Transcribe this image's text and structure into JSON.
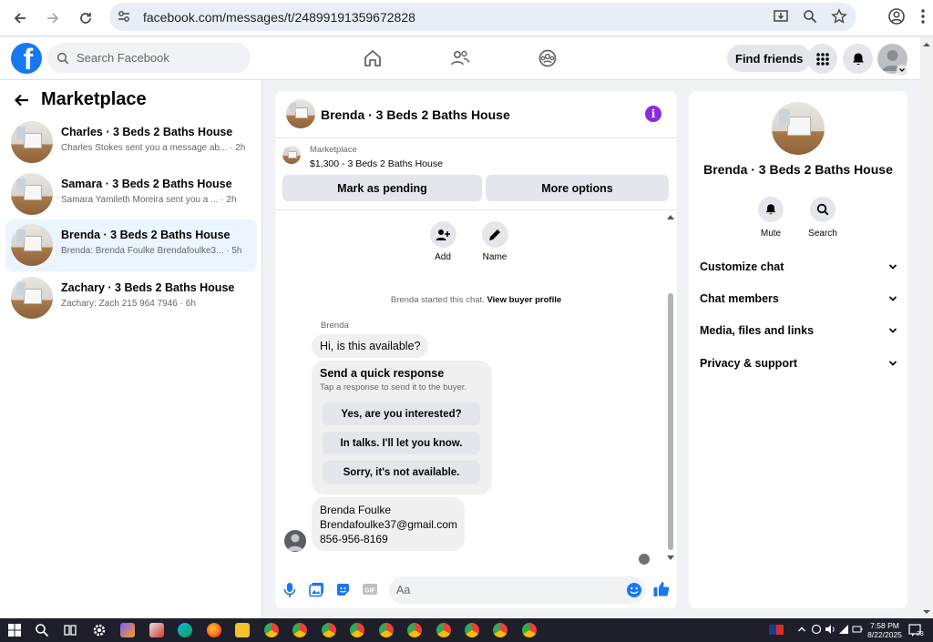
{
  "browser": {
    "url": "facebook.com/messages/t/24899191359672828"
  },
  "fb": {
    "search_placeholder": "Search Facebook",
    "find_friends": "Find friends"
  },
  "sidebar": {
    "title": "Marketplace",
    "threads": [
      {
        "title": "Charles · 3 Beds 2 Baths House",
        "snippet": "Charles Stokes sent you a message ab...",
        "time": "· 2h",
        "active": false
      },
      {
        "title": "Samara · 3 Beds 2 Baths House",
        "snippet": "Samara Yamileth Moreira sent you a ...",
        "time": "· 2h",
        "active": false
      },
      {
        "title": "Brenda · 3 Beds 2 Baths House",
        "snippet": "Brenda: Brenda Foulke Brendafoulke3...",
        "time": "· 5h",
        "active": true
      },
      {
        "title": "Zachary · 3 Beds 2 Baths House",
        "snippet": "Zachary: Zach 215 964 7946",
        "time": "· 6h",
        "active": false
      }
    ]
  },
  "chat": {
    "title": "Brenda · 3 Beds 2 Baths House",
    "marketplace_label": "Marketplace",
    "listing_price": "$1,300 - 3 Beds 2 Baths House",
    "mark_pending": "Mark as pending",
    "more_options": "More options",
    "add_label": "Add",
    "name_label": "Name",
    "system_msg": "Brenda started this chat.",
    "view_profile": "View buyer profile",
    "sender_name": "Brenda",
    "first_msg": "Hi, is this available?",
    "quick_title": "Send a quick response",
    "quick_sub": "Tap a response to send it to the buyer.",
    "quick_replies": [
      "Yes, are you interested?",
      "In talks. I'll let you know.",
      "Sorry, it's not available."
    ],
    "contact_lines": [
      "Brenda Foulke",
      "Brendafoulke37@gmail.com",
      "856-956-8169"
    ],
    "composer_placeholder": "Aa"
  },
  "info": {
    "name": "Brenda · 3 Beds 2 Baths House",
    "mute": "Mute",
    "search": "Search",
    "sections": [
      "Customize chat",
      "Chat members",
      "Media, files and links",
      "Privacy & support"
    ]
  },
  "taskbar": {
    "time": "7:58 PM",
    "date": "8/22/2025",
    "notif_count": "23"
  },
  "colors": {
    "fb_blue": "#1877f2",
    "active_thread": "#ebf5ff",
    "info_purple": "#8a2be2"
  }
}
